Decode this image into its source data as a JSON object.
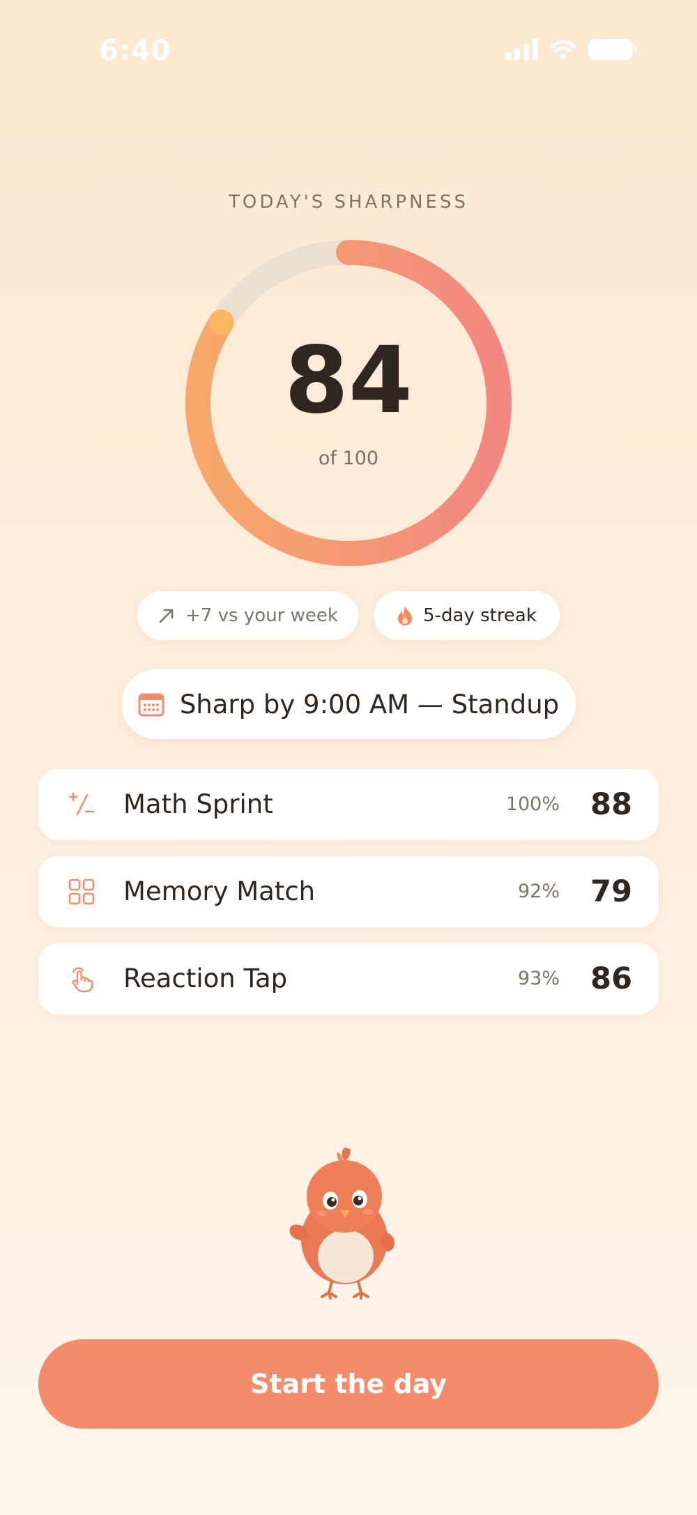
{
  "status_bar": {
    "time": "6:40",
    "signal_icon": "cellular-signal-icon",
    "wifi_icon": "wifi-icon",
    "battery_icon": "battery-icon"
  },
  "sharpness": {
    "label": "TODAY'S SHARPNESS",
    "score": "84",
    "out_of": "of 100",
    "progress_fraction": 0.84,
    "ring_colors": {
      "start": "#f7a96a",
      "end": "#f2877f",
      "track": "#ece0d2",
      "knob": "#f9b860"
    }
  },
  "pills": {
    "week": {
      "icon": "trend-up-arrow-icon",
      "label": "+7 vs your week"
    },
    "streak": {
      "icon": "flame-icon",
      "label": "5-day streak"
    }
  },
  "schedule": {
    "icon": "calendar-icon",
    "label": "Sharp by 9:00 AM — Standup"
  },
  "games": [
    {
      "icon": "plus-minus-icon",
      "name": "Math Sprint",
      "percent": "100%",
      "score": "88"
    },
    {
      "icon": "grid-squares-icon",
      "name": "Memory Match",
      "percent": "92%",
      "score": "79"
    },
    {
      "icon": "tap-hand-icon",
      "name": "Reaction Tap",
      "percent": "93%",
      "score": "86"
    }
  ],
  "mascot": {
    "icon": "bird-mascot-illustration"
  },
  "cta": {
    "label": "Start the day"
  },
  "colors": {
    "accent": "#f48c6c",
    "text": "#2f2620",
    "muted": "#7b7566"
  }
}
